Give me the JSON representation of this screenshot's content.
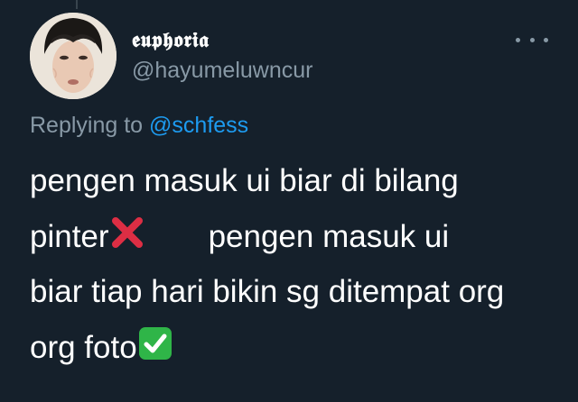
{
  "tweet": {
    "author": {
      "display_name": "𝖊𝖚𝖕𝖍𝖔𝖗𝖎𝖆",
      "username": "@hayumeluwncur",
      "avatar_icon": "profile-photo"
    },
    "more_icon": "more-horizontal-icon",
    "reply": {
      "prefix": "Replying to",
      "mention": "@schfess"
    },
    "text": {
      "line1": "pengen masuk ui biar di bilang",
      "line2a": "pinter",
      "emoji_cross": "❌",
      "line2b": "pengen masuk ui",
      "line3": "biar tiap hari bikin sg ditempat org",
      "line4": "org foto",
      "emoji_check": "✅"
    },
    "colors": {
      "background": "#15202b",
      "text_primary": "#ffffff",
      "text_secondary": "#8899a6",
      "link": "#1d9bf0",
      "cross_red": "#dd2e44",
      "check_green": "#2fb548"
    }
  }
}
